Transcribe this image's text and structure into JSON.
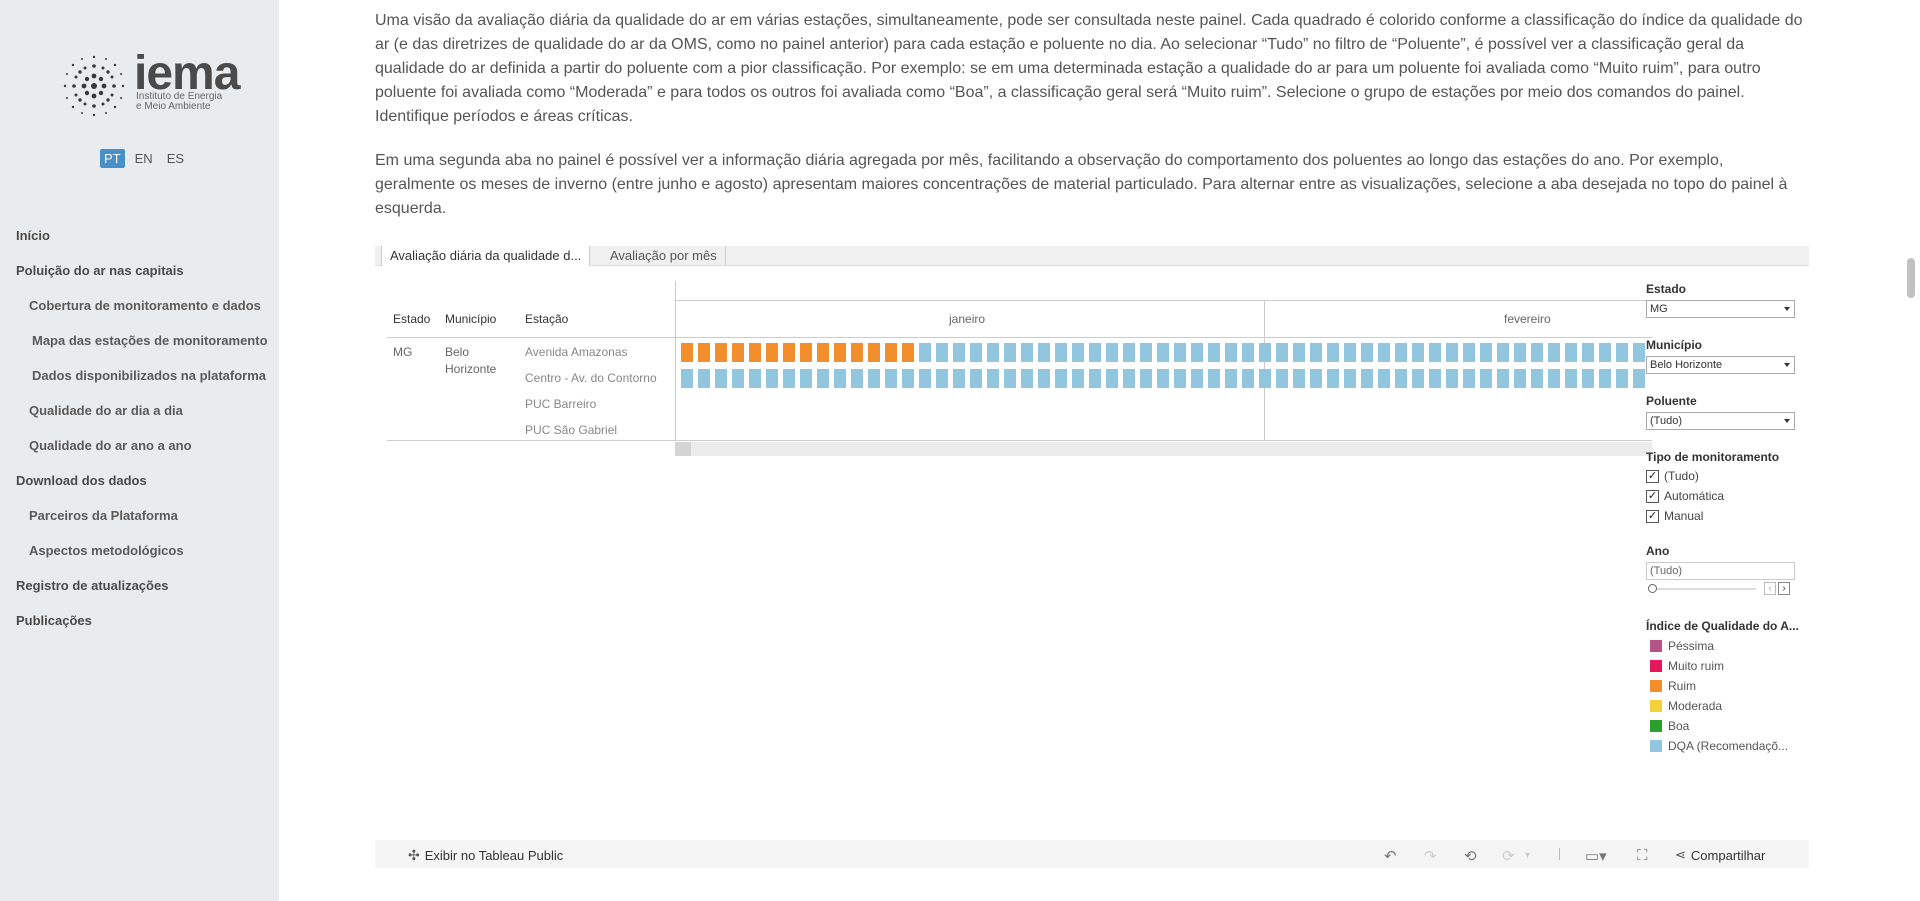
{
  "logo": {
    "word": "iema",
    "subtitle_line1": "Instituto de Energia",
    "subtitle_line2": "e Meio Ambiente"
  },
  "languages": [
    {
      "code": "PT",
      "active": true
    },
    {
      "code": "EN",
      "active": false
    },
    {
      "code": "ES",
      "active": false
    }
  ],
  "nav": {
    "inicio": "Início",
    "poluicao": "Poluição do ar nas capitais",
    "cobertura": "Cobertura de monitoramento e dados",
    "mapa": "Mapa das estações de monitoramento",
    "dados_disp": "Dados disponibilizados na plataforma",
    "dia_a_dia": "Qualidade do ar dia a dia",
    "ano_a_ano": "Qualidade do ar ano a ano",
    "download": "Download dos dados",
    "parceiros": "Parceiros da Plataforma",
    "aspectos": "Aspectos metodológicos",
    "registro": "Registro de atualizações",
    "publicacoes": "Publicações"
  },
  "content": {
    "paragraph1": "Uma visão da avaliação diária da qualidade do ar em várias estações, simultaneamente, pode ser consultada neste painel. Cada quadrado é colorido conforme a classificação do índice da qualidade do ar (e das diretrizes de qualidade do ar da OMS, como no painel anterior) para cada estação e poluente no dia. Ao selecionar “Tudo” no filtro de “Poluente”, é possível ver a classificação geral da qualidade do ar definida a partir do poluente com a pior classificação. Por exemplo: se em uma determinada estação a qualidade do ar para um poluente foi avaliada como “Muito ruim”, para outro poluente foi avaliada como “Moderada” e para todos os outros foi avaliada como “Boa”, a classificação geral será “Muito ruim”. Selecione o grupo de estações por meio dos comandos do painel. Identifique períodos e áreas críticas.",
    "paragraph2": "Em uma segunda aba no painel é possível ver a informação diária agregada por mês, facilitando a observação do comportamento dos poluentes ao longo das estações do ano. Por exemplo, geralmente os meses de inverno (entre junho e agosto) apresentam maiores concentrações de material particulado. Para alternar entre as visualizações, selecione a aba desejada no topo do painel à esquerda."
  },
  "tabs": {
    "tab1": "Avaliação diária da qualidade d...",
    "tab2": "Avaliação por mês"
  },
  "table": {
    "headers": {
      "estado": "Estado",
      "municipio": "Município",
      "estacao": "Estação"
    },
    "estado": "MG",
    "municipio_line1": "Belo",
    "municipio_line2": "Horizonte",
    "stations": [
      "Avenida Amazonas",
      "Centro - Av. do Contorno",
      "PUC Barreiro",
      "PUC São Gabriel"
    ],
    "months": [
      "janeiro",
      "fevereiro"
    ],
    "row1_colors": [
      "#f28e2b",
      "#f28e2b",
      "#f28e2b",
      "#f28e2b",
      "#f28e2b",
      "#f28e2b",
      "#f28e2b",
      "#f28e2b",
      "#f28e2b",
      "#f28e2b",
      "#f28e2b",
      "#f28e2b",
      "#f28e2b",
      "#f28e2b",
      "#92c5de",
      "#92c5de",
      "#92c5de",
      "#92c5de",
      "#92c5de",
      "#92c5de",
      "#92c5de",
      "#92c5de",
      "#92c5de",
      "#92c5de",
      "#92c5de",
      "#92c5de",
      "#92c5de",
      "#92c5de",
      "#92c5de",
      "#92c5de",
      "#92c5de",
      "#92c5de",
      "#92c5de",
      "#92c5de",
      "#92c5de",
      "#92c5de",
      "#92c5de",
      "#92c5de",
      "#92c5de",
      "#92c5de",
      "#92c5de",
      "#92c5de",
      "#92c5de",
      "#92c5de",
      "#92c5de",
      "#92c5de",
      "#92c5de",
      "#92c5de",
      "#92c5de",
      "#92c5de",
      "#92c5de",
      "#92c5de",
      "#92c5de",
      "#92c5de",
      "#92c5de",
      "#92c5de",
      "#92c5de"
    ],
    "row2_color": "#92c5de",
    "row2_count": 57
  },
  "filters": {
    "estado": {
      "label": "Estado",
      "value": "MG"
    },
    "municipio": {
      "label": "Município",
      "value": "Belo Horizonte"
    },
    "poluente": {
      "label": "Poluente",
      "value": "(Tudo)"
    },
    "tipo": {
      "label": "Tipo de monitoramento",
      "options": [
        "(Tudo)",
        "Automática",
        "Manual"
      ]
    },
    "ano": {
      "label": "Ano",
      "value": "(Tudo)"
    },
    "legend_title": "Índice de Qualidade do A...",
    "legend": [
      {
        "label": "Péssima",
        "color": "#b6538a"
      },
      {
        "label": "Muito ruim",
        "color": "#e8175d"
      },
      {
        "label": "Ruim",
        "color": "#f28e2b"
      },
      {
        "label": "Moderada",
        "color": "#f2d13b"
      },
      {
        "label": "Boa",
        "color": "#2ca02c"
      },
      {
        "label": "DQA (Recomendaçõ...",
        "color": "#92c5de"
      }
    ]
  },
  "toolbar": {
    "view_label": "Exibir no Tableau Public",
    "share_label": "Compartilhar"
  }
}
